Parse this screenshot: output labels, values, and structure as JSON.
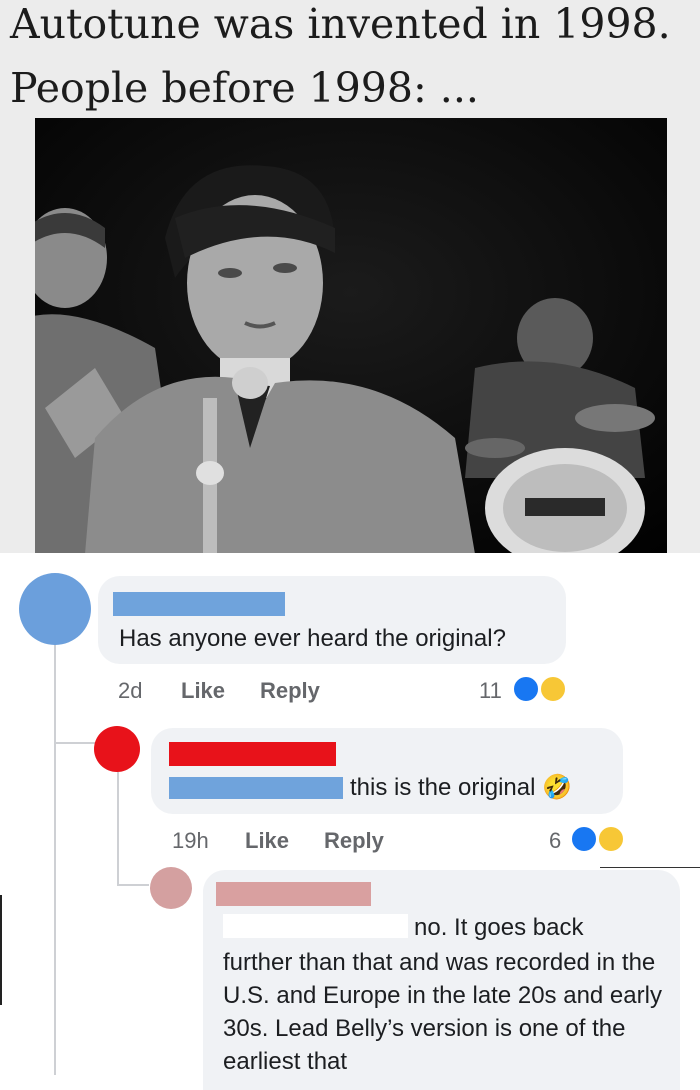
{
  "meme": {
    "caption_line1": "Autotune was invented in 1998.",
    "caption_line2": "People before 1998: ..."
  },
  "comments": [
    {
      "name": "",
      "name_color": "#6fa3dc",
      "avatar_color": "#6b9fdc",
      "text": "Has anyone ever heard the original?",
      "time": "2d",
      "like_label": "Like",
      "reply_label": "Reply",
      "reaction_count": "11"
    },
    {
      "name": "",
      "name_color": "#e8121a",
      "avatar_color": "#e8121a",
      "mention_color": "#6fa3dc",
      "text": "this is the original 🤣",
      "time": "19h",
      "like_label": "Like",
      "reply_label": "Reply",
      "reaction_count": "6"
    },
    {
      "name": "",
      "name_color": "#d9a0a0",
      "avatar_color": "#d4a0a0",
      "text_line1": "no. It goes back",
      "text_rest": "further than that and was recorded in the U.S. and Europe in the late 20s and early 30s. Lead Belly’s version is one of the earliest that"
    }
  ]
}
